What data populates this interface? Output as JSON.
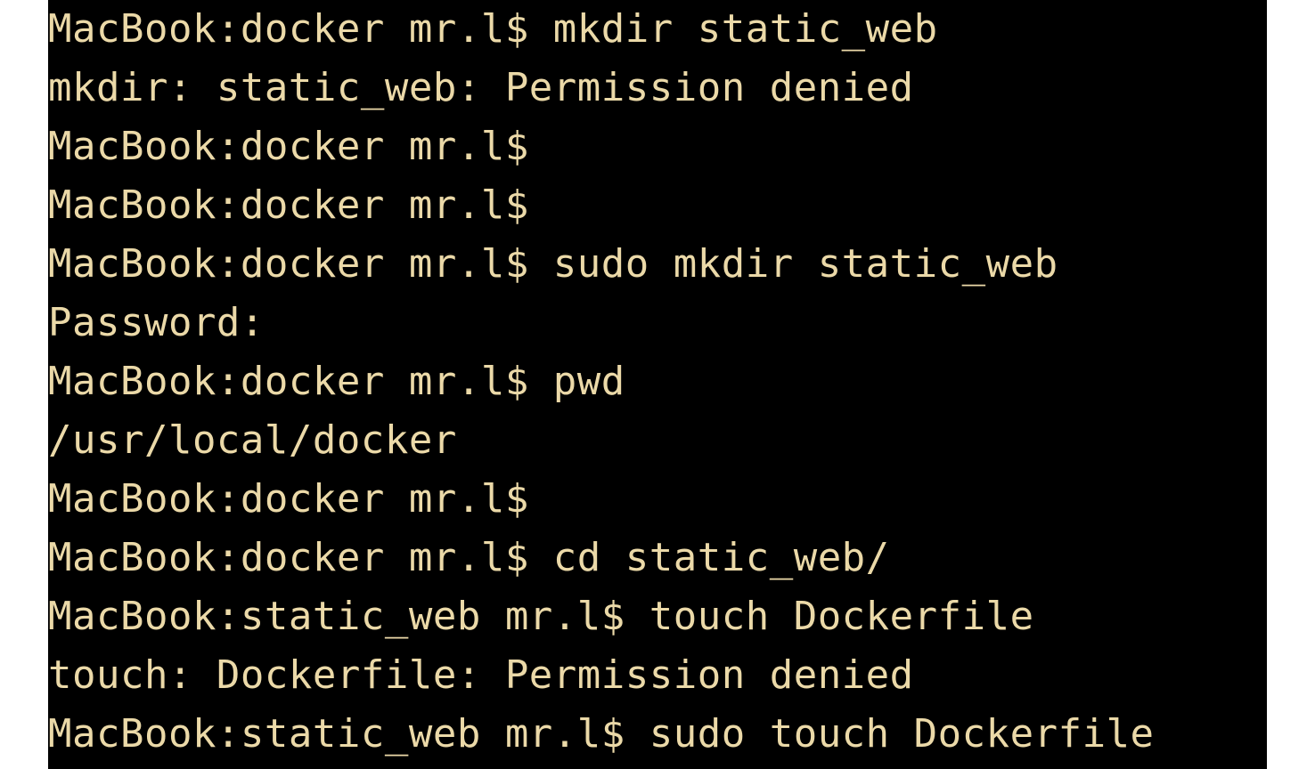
{
  "terminal": {
    "lines": [
      "MacBook:docker mr.l$ mkdir static_web",
      "mkdir: static_web: Permission denied",
      "MacBook:docker mr.l$ ",
      "MacBook:docker mr.l$ ",
      "MacBook:docker mr.l$ sudo mkdir static_web",
      "Password:",
      "MacBook:docker mr.l$ pwd",
      "/usr/local/docker",
      "MacBook:docker mr.l$ ",
      "MacBook:docker mr.l$ cd static_web/",
      "MacBook:static_web mr.l$ touch Dockerfile",
      "touch: Dockerfile: Permission denied",
      "MacBook:static_web mr.l$ sudo touch Dockerfile"
    ]
  }
}
